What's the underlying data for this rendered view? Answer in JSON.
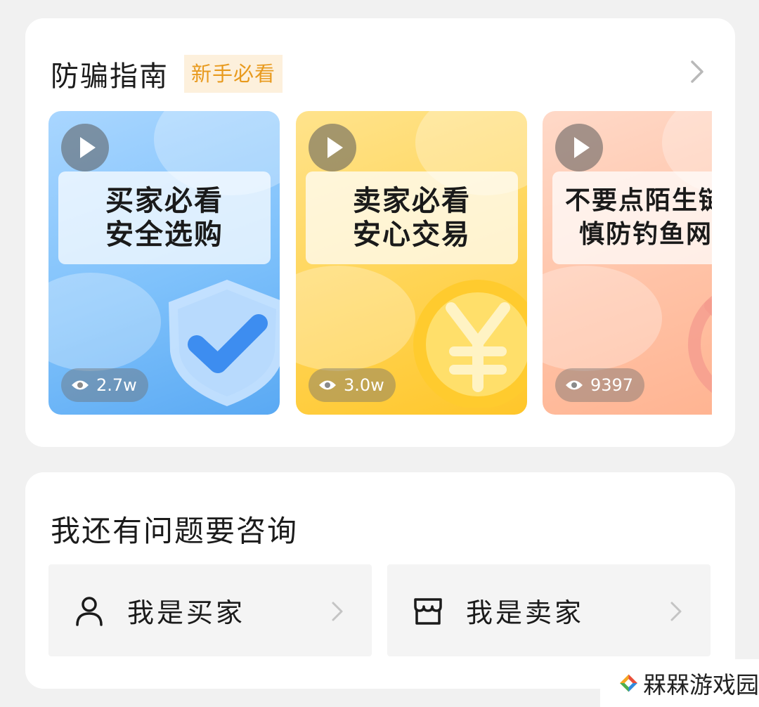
{
  "guide": {
    "title": "防骗指南",
    "badge": "新手必看",
    "videos": [
      {
        "line1": "买家必看",
        "line2": "安全选购",
        "views": "2.7w",
        "icon": "shield-check-icon"
      },
      {
        "line1": "卖家必看",
        "line2": "安心交易",
        "views": "3.0w",
        "icon": "yuan-coin-icon"
      },
      {
        "line1": "不要点陌生链",
        "line2": "慎防钓鱼网",
        "views": "9397",
        "icon": "no-link-icon"
      }
    ]
  },
  "consult": {
    "title": "我还有问题要咨询",
    "buyer_label": "我是买家",
    "seller_label": "我是卖家"
  },
  "watermark": {
    "text": "槑槑游戏园"
  },
  "colors": {
    "badge_text": "#e89a1e",
    "badge_bg": "#fdf0dc",
    "card_blue": "#7ec1fb",
    "card_yellow": "#ffd454",
    "card_peach": "#ffc2a6"
  }
}
